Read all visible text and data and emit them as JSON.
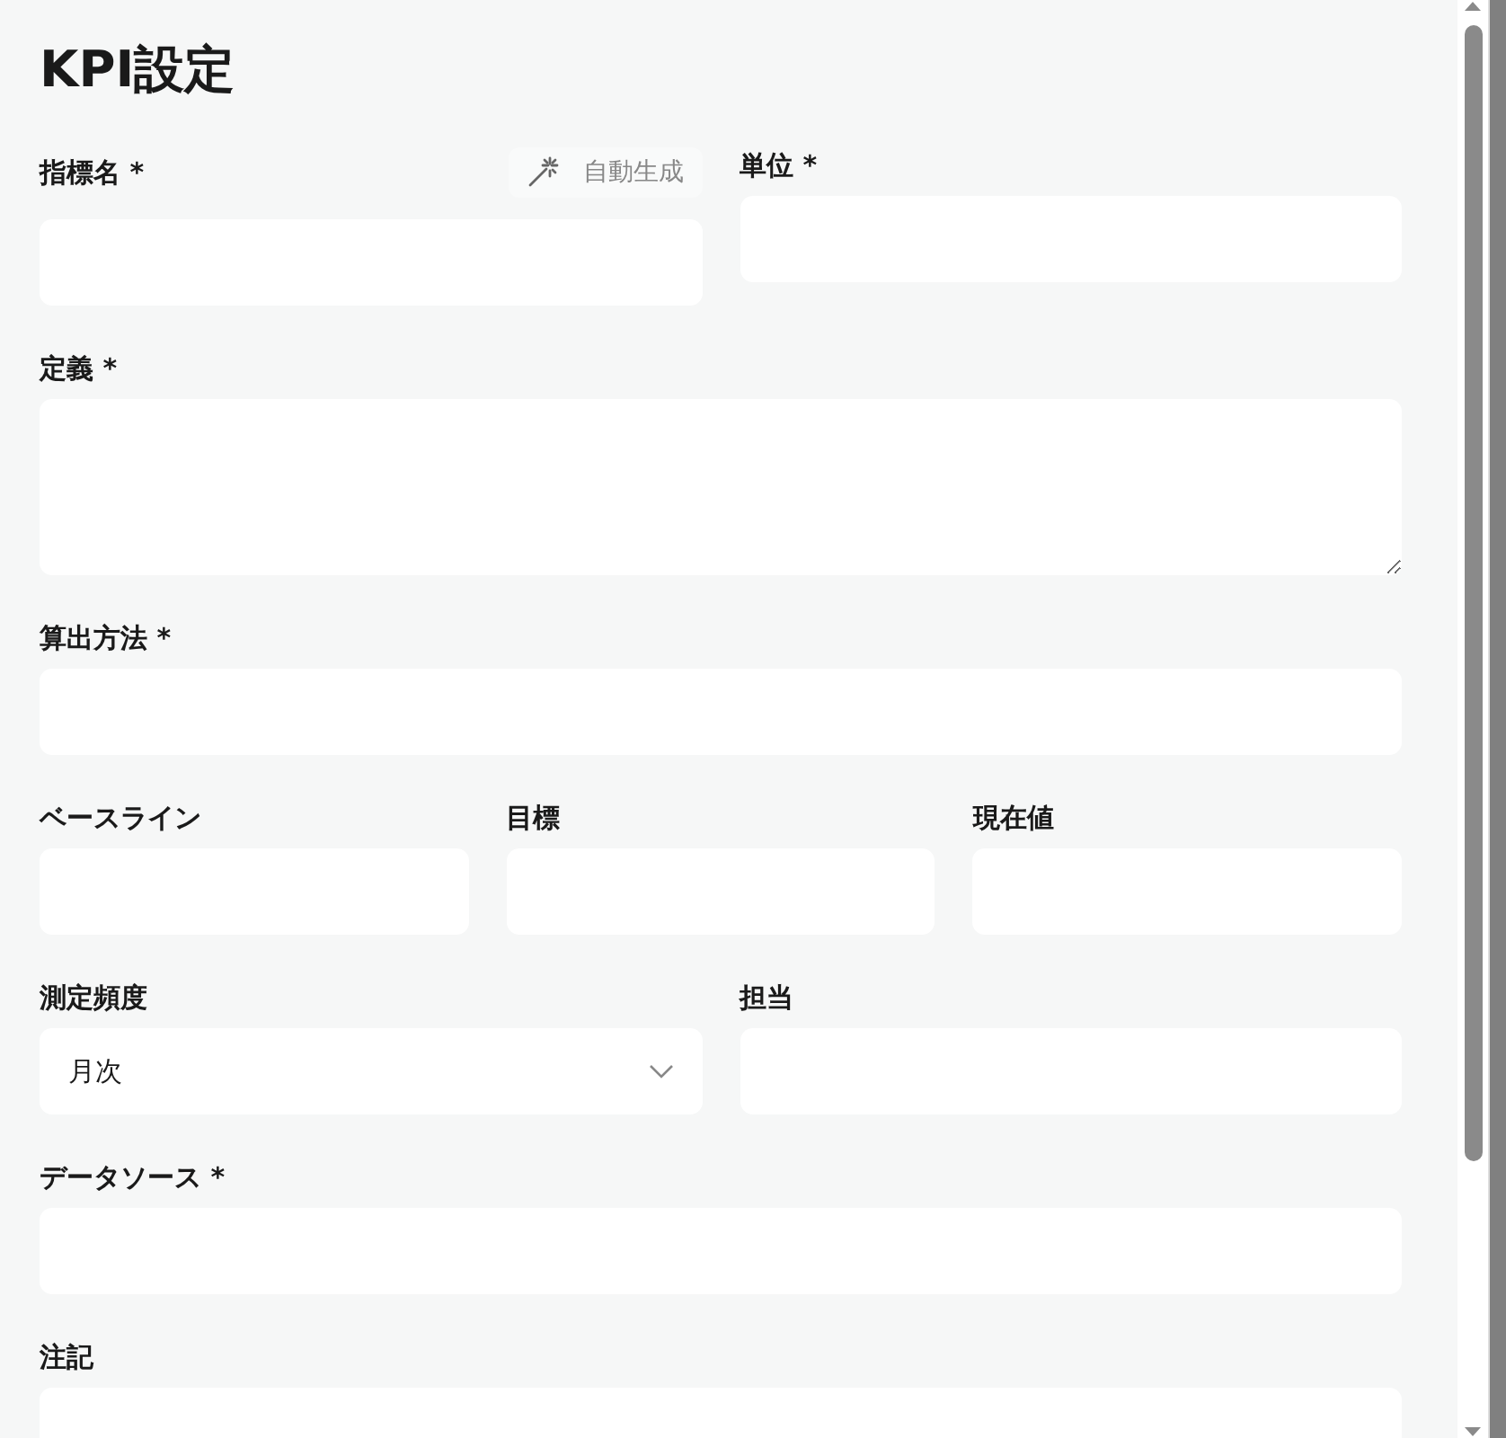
{
  "title": "KPI設定",
  "rows": [
    {
      "fields": [
        {
          "label": "指標名 *",
          "kind": "text",
          "action": {
            "label": "自動生成"
          }
        },
        {
          "label": "単位 *",
          "kind": "text"
        }
      ]
    },
    {
      "fields": [
        {
          "label": "定義 *",
          "kind": "textarea"
        }
      ]
    },
    {
      "fields": [
        {
          "label": "算出方法 *",
          "kind": "text"
        }
      ]
    },
    {
      "fields": [
        {
          "label": "ベースライン",
          "kind": "text"
        },
        {
          "label": "目標",
          "kind": "text"
        },
        {
          "label": "現在値",
          "kind": "text"
        }
      ]
    },
    {
      "fields": [
        {
          "label": "測定頻度",
          "kind": "select",
          "value": "月次"
        },
        {
          "label": "担当",
          "kind": "text"
        }
      ]
    },
    {
      "fields": [
        {
          "label": "データソース *",
          "kind": "text"
        }
      ]
    },
    {
      "fields": [
        {
          "label": "注記",
          "kind": "text"
        }
      ]
    }
  ]
}
